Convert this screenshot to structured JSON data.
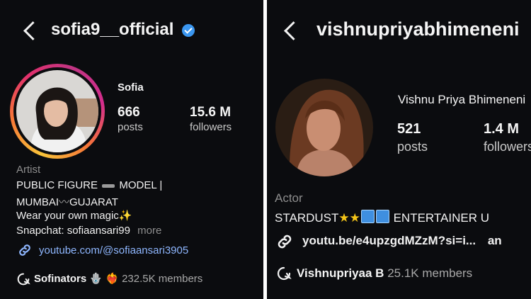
{
  "left": {
    "username": "sofia9__official",
    "verified": true,
    "name": "Sofia",
    "posts_count": "666",
    "posts_label": "posts",
    "followers_count": "15.6 M",
    "followers_label": "followers",
    "category": "Artist",
    "bio_line1_a": "PUBLIC FIGURE",
    "bio_line1_b": "MODEL |",
    "bio_line2_a": "MUMBAI",
    "bio_line2_sep": "〰",
    "bio_line2_b": "GUJARAT",
    "bio_line3": "Wear your own magic",
    "bio_line3_emoji": "✨",
    "bio_line4": "Snapchat: sofiaansari99",
    "more_label": "more",
    "link": "youtube.com/@sofiaansari3905",
    "channel_name": "Sofinators",
    "channel_emojis": "🪬 ❤️‍🔥",
    "channel_members": "232.5K members"
  },
  "right": {
    "username": "vishnupriyabhimeneni",
    "name": "Vishnu Priya Bhimeneni",
    "posts_count": "521",
    "posts_label": "posts",
    "followers_count": "1.4 M",
    "followers_label": "followers",
    "category": "Actor",
    "bio_line1_a": "STARDUST",
    "bio_line1_b": "ENTERTAINER U",
    "link": "youtu.be/e4upzgdMZzM?si=i...",
    "link_more": "an",
    "channel_name": "Vishnupriyaa B",
    "channel_members": "25.1K members"
  },
  "colors": {
    "background": "#0b0c0f",
    "link": "#8fb7ff",
    "verified": "#3b97f0",
    "muted": "#8e8e8e"
  }
}
